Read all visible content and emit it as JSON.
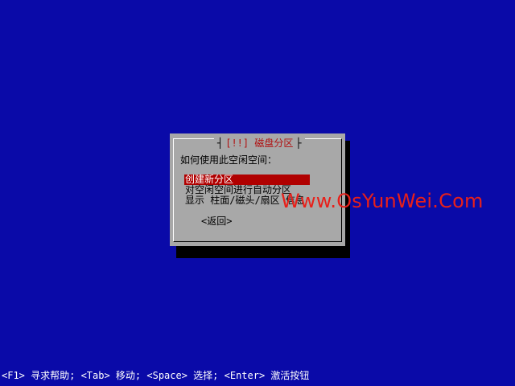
{
  "dialog": {
    "title": "[!!] 磁盘分区",
    "prompt": "如何使用此空闲空间：",
    "menu_items": [
      {
        "label": "创建新分区",
        "selected": true
      },
      {
        "label": "对空闲空间进行自动分区",
        "selected": false
      },
      {
        "label": "显示 柱面/磁头/扇区 信息",
        "selected": false
      }
    ],
    "back_label": "<返回>"
  },
  "watermark": "Www.OsYunWei.Com",
  "helpbar": "<F1> 寻求帮助; <Tab> 移动; <Space> 选择; <Enter> 激活按钮",
  "colors": {
    "background": "#0a0aa8",
    "dialog": "#a8a8a8",
    "title": "#b01010",
    "selection": "#b00000",
    "watermark": "#e8201a"
  }
}
